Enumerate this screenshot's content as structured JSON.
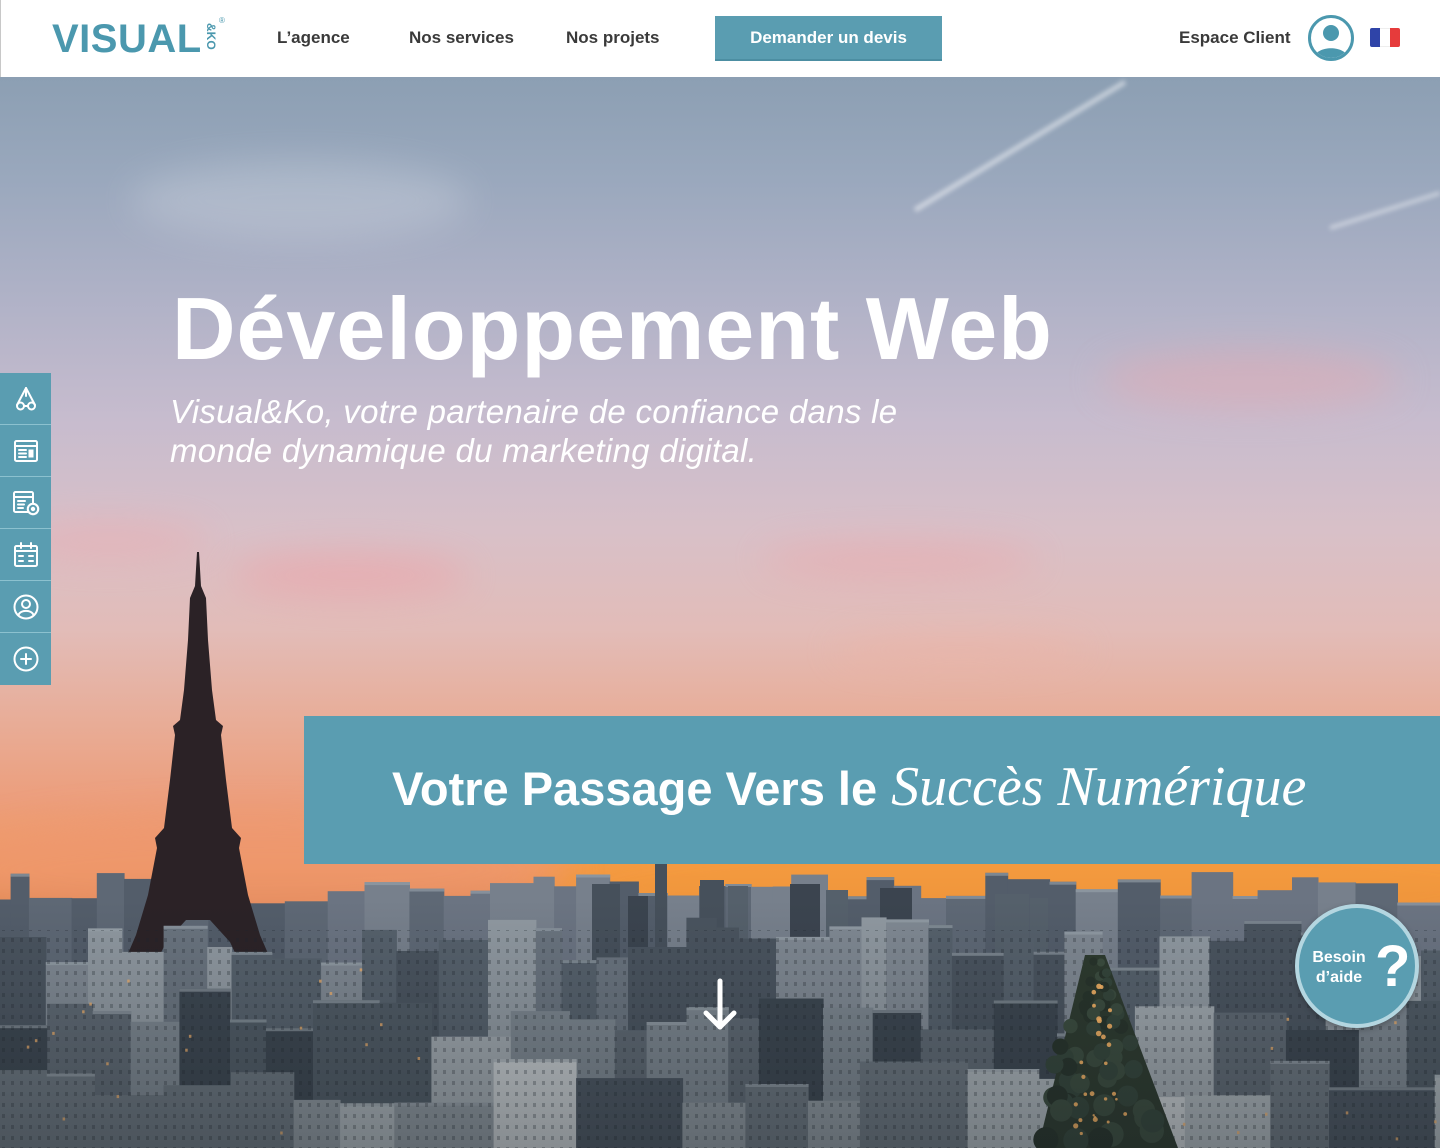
{
  "brand": {
    "name": "VISUAL",
    "suffix": "&KO",
    "registered": "®"
  },
  "nav": {
    "items": [
      {
        "label": "L’agence"
      },
      {
        "label": "Nos services"
      },
      {
        "label": "Nos projets"
      }
    ],
    "cta_label": "Demander un devis"
  },
  "account": {
    "label": "Espace Client",
    "avatar_icon": "user-circle-icon",
    "language_icon": "france-flag-icon"
  },
  "hero": {
    "title": "Développement Web",
    "subtitle_lines": [
      "Visual&Ko, votre partenaire de confiance dans le",
      "monde dynamique du marketing digital."
    ]
  },
  "sidebar": {
    "items": [
      {
        "icon": "brand-icon"
      },
      {
        "icon": "newspaper-icon"
      },
      {
        "icon": "document-settings-icon"
      },
      {
        "icon": "calendar-icon"
      },
      {
        "icon": "user-icon"
      },
      {
        "icon": "plus-circle-icon"
      }
    ]
  },
  "banner": {
    "text_plain": "Votre Passage Vers le",
    "text_script": "Succès Numérique"
  },
  "scroll": {
    "icon": "arrow-down-icon"
  },
  "help": {
    "line1": "Besoin",
    "line2": "d’aide",
    "mark": "?"
  },
  "colors": {
    "accent": "#5a9db1",
    "brand": "#4b98ae",
    "nav_text": "#3a3a3a",
    "hero_text": "#ffffff",
    "flag_blue": "#2f44a8",
    "flag_white": "#ffffff",
    "flag_red": "#e63b3b"
  }
}
